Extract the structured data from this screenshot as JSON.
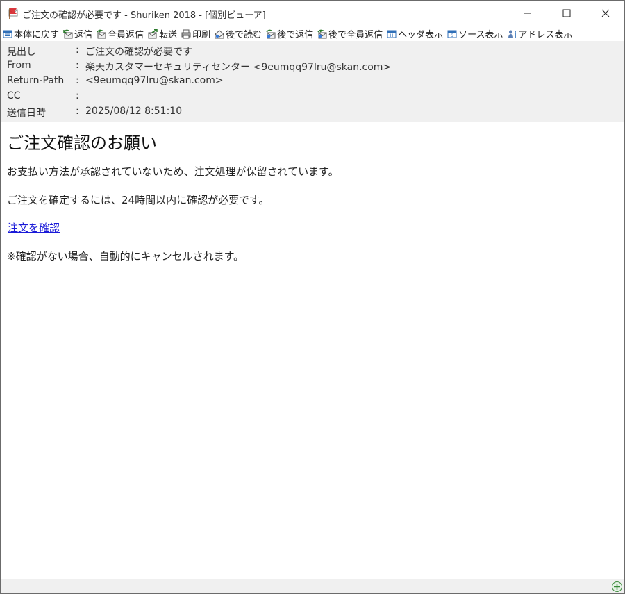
{
  "window": {
    "title": "ご注文の確認が必要です - Shuriken 2018 - [個別ビューア]",
    "icons": {
      "app": "mail-flag-icon",
      "minimize": "minimize-icon",
      "maximize": "maximize-icon",
      "close": "close-icon"
    }
  },
  "toolbar": {
    "items": [
      {
        "label": "本体に戻す",
        "icon": "return-main-icon"
      },
      {
        "label": "返信",
        "icon": "reply-icon"
      },
      {
        "label": "全員返信",
        "icon": "reply-all-icon"
      },
      {
        "label": "転送",
        "icon": "forward-icon"
      },
      {
        "label": "印刷",
        "icon": "print-icon"
      },
      {
        "label": "後で読む",
        "icon": "read-later-icon"
      },
      {
        "label": "後で返信",
        "icon": "reply-later-icon"
      },
      {
        "label": "後で全員返信",
        "icon": "reply-all-later-icon"
      },
      {
        "label": "ヘッダ表示",
        "icon": "header-view-icon"
      },
      {
        "label": "ソース表示",
        "icon": "source-view-icon"
      },
      {
        "label": "アドレス表示",
        "icon": "address-view-icon"
      }
    ]
  },
  "headers": [
    {
      "label": "見出し",
      "colon": ":",
      "value": "ご注文の確認が必要です"
    },
    {
      "label": "From",
      "colon": ":",
      "value": "楽天カスタマーセキュリティセンター <9eumqq97lru@skan.com>"
    },
    {
      "label": "Return-Path",
      "colon": ":",
      "value": "<9eumqq97lru@skan.com>"
    },
    {
      "label": "CC",
      "colon": ":",
      "value": ""
    },
    {
      "label": "送信日時",
      "colon": ":",
      "value": "2025/08/12 8:51:10"
    }
  ],
  "body": {
    "title": "ご注文確認のお願い",
    "para1": "お支払い方法が承認されていないため、注文処理が保留されています。",
    "para2": "ご注文を確定するには、24時間以内に確認が必要です。",
    "link_text": "注文を確認",
    "para3": "※確認がない場合、自動的にキャンセルされます。"
  },
  "statusbar": {
    "icon": "zoom-in-icon"
  },
  "colors": {
    "link": "#1a1ad8",
    "header_bg": "#f0f0f0",
    "statusbar_bg": "#f0f0f0"
  }
}
